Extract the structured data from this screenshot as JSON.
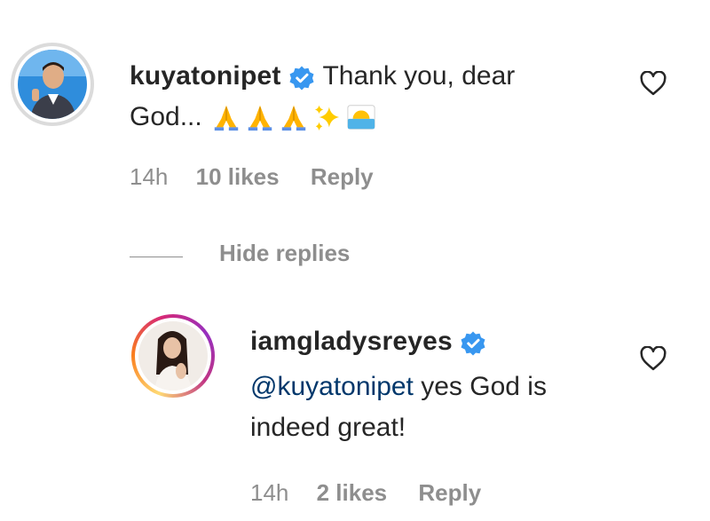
{
  "comments": [
    {
      "username": "kuyatonipet",
      "text_line1": "Thank you, dear",
      "text_line2": "God...",
      "emojis": [
        "folded-hands",
        "folded-hands",
        "folded-hands",
        "sparkles",
        "sunrise"
      ],
      "time": "14h",
      "likes": "10 likes",
      "reply_label": "Reply",
      "verified": true
    },
    {
      "username": "iamgladysreyes",
      "mention": "@kuyatonipet",
      "text_line1_rest": " yes God is",
      "text_line2": "indeed great!",
      "time": "14h",
      "likes": "2 likes",
      "reply_label": "Reply",
      "verified": true
    }
  ],
  "replies_toggle": {
    "label": "Hide replies"
  },
  "colors": {
    "text": "#262626",
    "meta": "#8e8e8e",
    "mention": "#00376b",
    "verified": "#3897f0"
  },
  "icons": [
    "heart-outline-icon",
    "verified-badge-icon"
  ]
}
